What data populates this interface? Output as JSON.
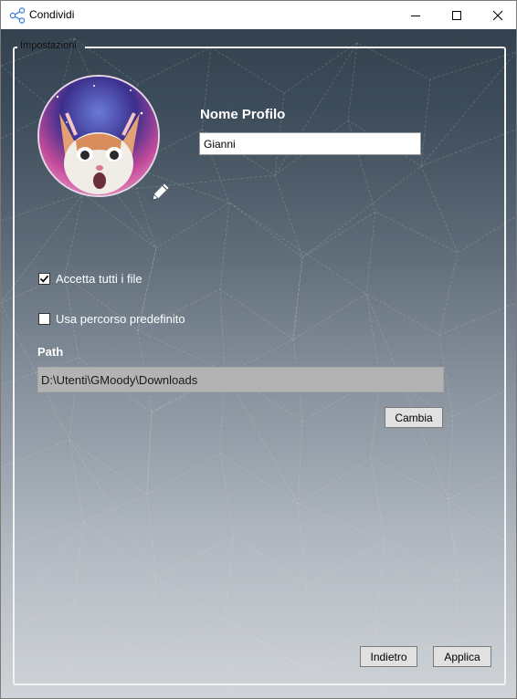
{
  "window": {
    "title": "Condividi",
    "icon": "share-icon",
    "controls": [
      "minimize-icon",
      "maximize-icon",
      "close-icon"
    ]
  },
  "settings": {
    "group_label": "Impostazioni",
    "profile_name_label": "Nome Profilo",
    "profile_name_value": "Gianni",
    "avatar": "cat-profile-picture",
    "edit_icon": "pencil-icon",
    "accept_all_files": {
      "label": "Accetta tutti i file",
      "checked": true
    },
    "use_default_path": {
      "label": "Usa percorso predefinito",
      "checked": false
    },
    "path_label": "Path",
    "path_value": "D:\\Utenti\\GMoody\\Downloads",
    "change_button": "Cambia"
  },
  "footer": {
    "back_button": "Indietro",
    "apply_button": "Applica"
  }
}
